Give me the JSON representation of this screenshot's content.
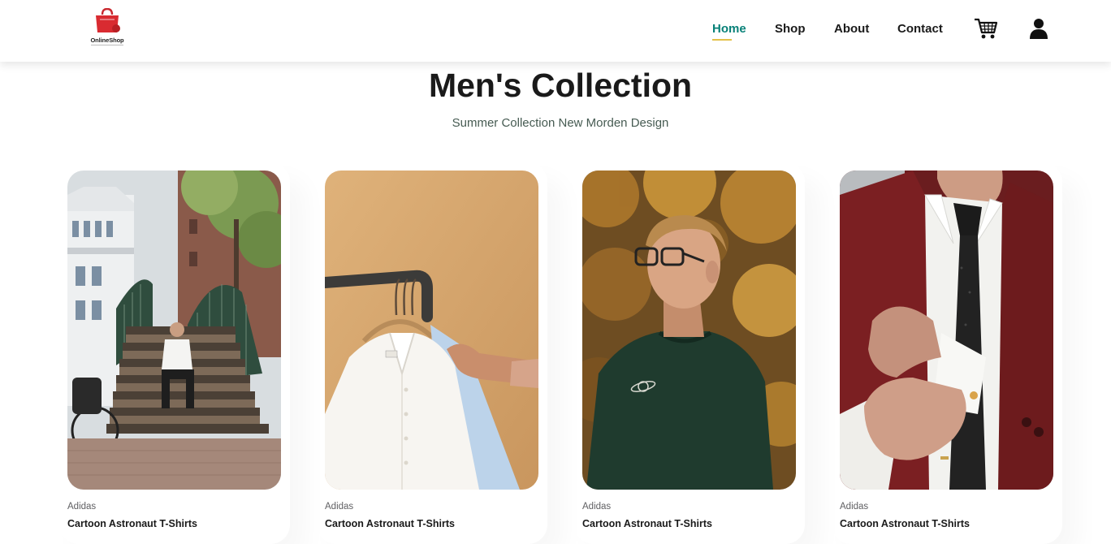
{
  "header": {
    "logo_text": "OnlineShop",
    "nav": [
      {
        "label": "Home",
        "active": true
      },
      {
        "label": "Shop",
        "active": false
      },
      {
        "label": "About",
        "active": false
      },
      {
        "label": "Contact",
        "active": false
      }
    ],
    "icons": [
      "cart-icon",
      "user-icon"
    ]
  },
  "colors": {
    "accent": "#088178",
    "underline": "#e3c14a",
    "text": "#1a1a1a"
  },
  "main": {
    "title": "Men's Collection",
    "subtitle": "Summer Collection New Morden Design",
    "products": [
      {
        "brand": "Adidas",
        "name": "Cartoon Astronaut T-Shirts"
      },
      {
        "brand": "Adidas",
        "name": "Cartoon Astronaut T-Shirts"
      },
      {
        "brand": "Adidas",
        "name": "Cartoon Astronaut T-Shirts"
      },
      {
        "brand": "Adidas",
        "name": "Cartoon Astronaut T-Shirts"
      }
    ]
  }
}
